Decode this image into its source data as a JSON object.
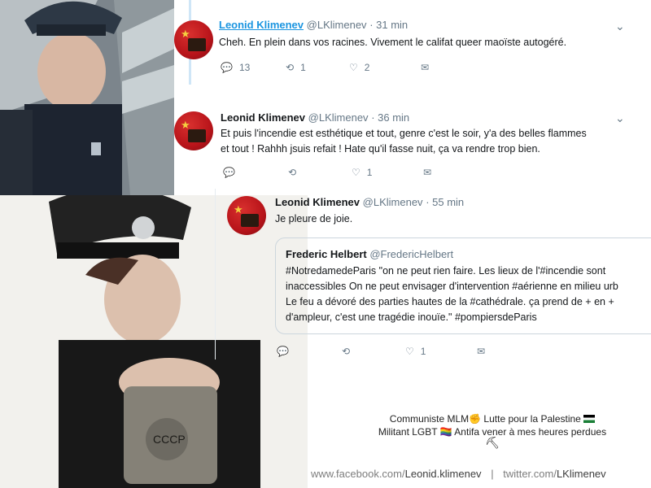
{
  "tweets": [
    {
      "name": "Leonid Klimenev",
      "handle": "@LKlimenev",
      "time": "· 31 min",
      "text": "Cheh. En plein dans vos racines. Vivement le califat queer maoïste autogéré.",
      "replies": "13",
      "retweets": "1",
      "likes": "2"
    },
    {
      "name": "Leonid Klimenev",
      "handle": "@LKlimenev",
      "time": "· 36 min",
      "text_line1": "Et puis l'incendie est esthétique et tout, genre c'est le soir, y'a des belles flammes",
      "text_line2": "et tout ! Rahhh jsuis refait ! Hate qu'il fasse nuit, ça va rendre trop bien.",
      "replies": "",
      "retweets": "",
      "likes": "1"
    },
    {
      "name": "Leonid Klimenev",
      "handle": "@LKlimenev",
      "time": "· 55 min",
      "text": "Je pleure de joie.",
      "replies": "",
      "retweets": "",
      "likes": "1",
      "quote": {
        "name": "Frederic Helbert",
        "handle": "@FredericHelbert",
        "line1": "#NotredamedeParis \"on ne peut rien faire. Les lieux de l'#incendie sont",
        "line2": "inaccessibles On ne peut envisager d'intervention #aérienne en milieu urb",
        "line3": "Le feu a dévoré des parties hautes de la #cathédrale. ça prend de + en +",
        "line4": "d'ampleur, c'est une tragédie inouïe.\" #pompiersdeParis"
      }
    }
  ],
  "caption": {
    "line1": "Communiste MLM✊ Lutte pour la Palestine",
    "line2": "Militant LGBT 🏳️‍🌈 Antifa vener à mes heures perdues"
  },
  "footer": {
    "fb_prefix": "www.facebook.com/",
    "fb_user": "Leonid.klimenev",
    "separator": "|",
    "tw_prefix": "twitter.com/",
    "tw_user": "LKlimenev"
  },
  "badge": {
    "text": "СССР"
  },
  "colors": {
    "link_blue": "#1b95e0",
    "muted": "#657786",
    "avatar_red": "#c0151b"
  }
}
